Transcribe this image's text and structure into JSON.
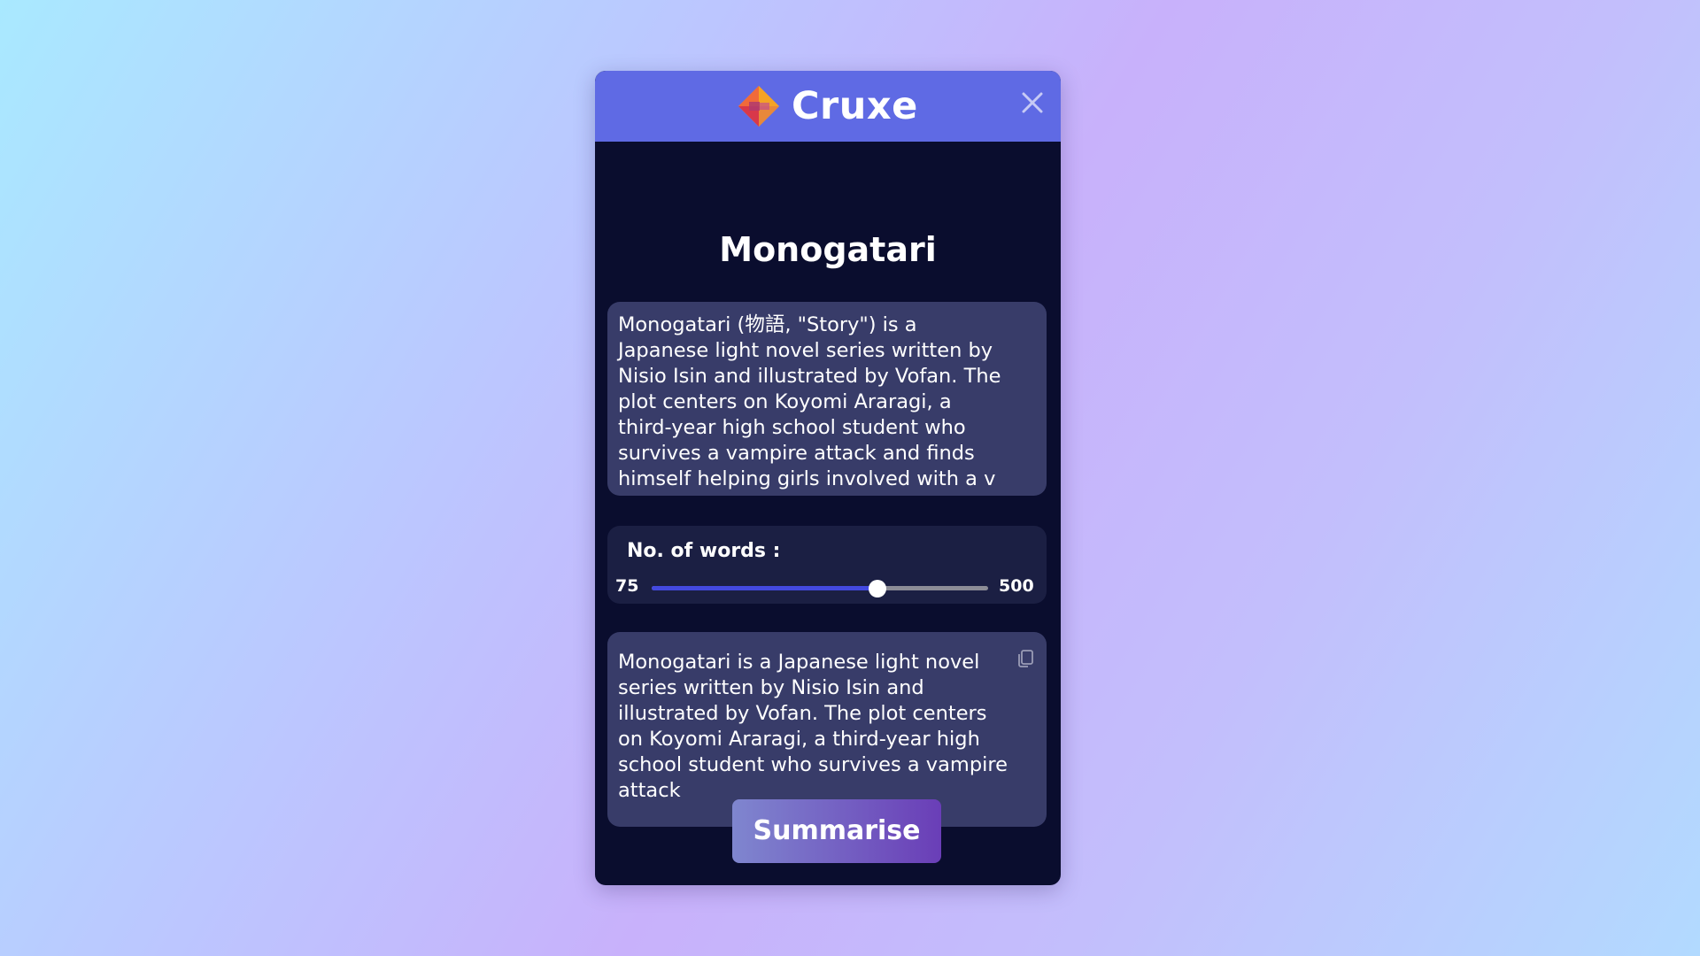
{
  "header": {
    "app_name": "Cruxe",
    "logo_icon": "cruxe-logo-icon",
    "close_icon": "close-icon"
  },
  "page": {
    "title": "Monogatari"
  },
  "source": {
    "text": "Monogatari (物語, \"Story\") is a\nJapanese light novel series written by\nNisio Isin and illustrated by Vofan. The\nplot centers on Koyomi Araragi, a\nthird-year high school student who\nsurvives a vampire attack and finds\nhimself helping girls involved with a v"
  },
  "words": {
    "label": "No. of words :",
    "min_label": "75",
    "max_label": "500",
    "min": 75,
    "max": 500,
    "value": 360
  },
  "summary": {
    "text": "Monogatari is a Japanese light novel\nseries written by Nisio Isin and\nillustrated by Vofan. The plot centers\non Koyomi Araragi, a third-year high\nschool student who survives a vampire\nattack",
    "copy_icon": "copy-icon"
  },
  "actions": {
    "summarise_label": "Summarise"
  },
  "colors": {
    "header": "#5f6ae4",
    "panel": "#0a0d2e",
    "card": "#383c69",
    "slider_fill": "#4349e0",
    "button_start": "#7f86cf",
    "button_end": "#6a3eb7"
  }
}
